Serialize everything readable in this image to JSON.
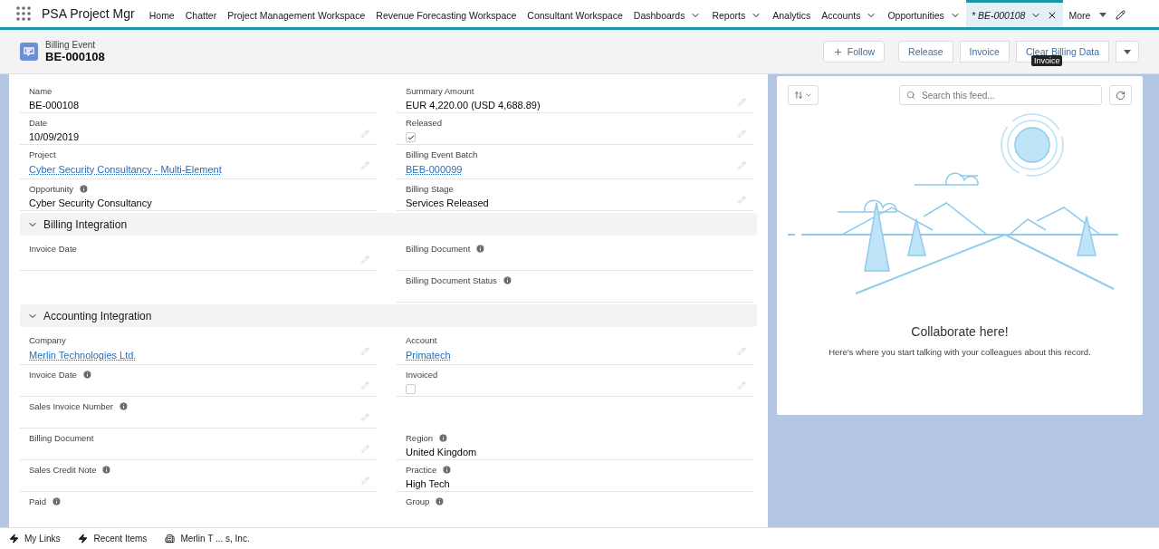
{
  "app": {
    "name": "PSA Project Mgr"
  },
  "nav_items": [
    {
      "label": "Home",
      "dropdown": false,
      "selected": false,
      "closable": false
    },
    {
      "label": "Chatter",
      "dropdown": false,
      "selected": false,
      "closable": false
    },
    {
      "label": "Project Management Workspace",
      "dropdown": false,
      "selected": false,
      "closable": false
    },
    {
      "label": "Revenue Forecasting Workspace",
      "dropdown": false,
      "selected": false,
      "closable": false
    },
    {
      "label": "Consultant Workspace",
      "dropdown": false,
      "selected": false,
      "closable": false
    },
    {
      "label": "Dashboards",
      "dropdown": true,
      "selected": false,
      "closable": false
    },
    {
      "label": "Reports",
      "dropdown": true,
      "selected": false,
      "closable": false
    },
    {
      "label": "Analytics",
      "dropdown": false,
      "selected": false,
      "closable": false
    },
    {
      "label": "Accounts",
      "dropdown": true,
      "selected": false,
      "closable": false
    },
    {
      "label": "Opportunities",
      "dropdown": true,
      "selected": false,
      "closable": false
    },
    {
      "label": "* BE-000108",
      "dropdown": true,
      "selected": true,
      "closable": true
    }
  ],
  "nav_more": "More",
  "record": {
    "type": "Billing Event",
    "title": "BE-000108"
  },
  "actions": [
    {
      "kind": "follow",
      "label": "Follow"
    },
    {
      "kind": "group",
      "label": "Release"
    },
    {
      "kind": "group",
      "label": "Invoice"
    },
    {
      "kind": "group",
      "label": "Clear Billing Data"
    },
    {
      "kind": "menu"
    }
  ],
  "tooltip": "Invoice",
  "sections": [
    {
      "rows": [
        {
          "left": {
            "label": "Name",
            "info": false,
            "kind": "text",
            "value": "BE-000108",
            "editable": false
          },
          "right": {
            "label": "Summary Amount",
            "info": false,
            "kind": "text",
            "value": "EUR 4,220.00 (USD 4,688.89)",
            "editable": true
          }
        },
        {
          "left": {
            "label": "Date",
            "info": false,
            "kind": "text",
            "value": "10/09/2019",
            "editable": true
          },
          "right": {
            "label": "Released",
            "info": false,
            "kind": "checkbox",
            "checked": true,
            "editable": true
          }
        },
        {
          "left": {
            "label": "Project",
            "info": false,
            "kind": "link",
            "value": "Cyber Security Consultancy - Multi-Element",
            "editable": true
          },
          "right": {
            "label": "Billing Event Batch",
            "info": false,
            "kind": "link",
            "value": "BEB-000099",
            "editable": true
          }
        },
        {
          "left": {
            "label": "Opportunity",
            "info": true,
            "kind": "text",
            "value": "Cyber Security Consultancy",
            "editable": false
          },
          "right": {
            "label": "Billing Stage",
            "info": false,
            "kind": "text",
            "value": "Services Released",
            "editable": true
          }
        }
      ]
    },
    {
      "title": "Billing Integration",
      "expanded": true,
      "rows": [
        {
          "left": {
            "label": "Invoice Date",
            "info": false,
            "kind": "empty",
            "editable": true
          },
          "right": {
            "label": "Billing Document",
            "info": true,
            "kind": "empty",
            "editable": false
          }
        },
        {
          "right": {
            "label": "Billing Document Status",
            "info": true,
            "kind": "empty",
            "editable": false
          }
        }
      ]
    },
    {
      "title": "Accounting Integration",
      "expanded": true,
      "rows": [
        {
          "left": {
            "label": "Company",
            "info": false,
            "kind": "link",
            "value": "Merlin Technologies Ltd.",
            "editable": true
          },
          "right": {
            "label": "Account",
            "info": false,
            "kind": "link",
            "value": "Primatech",
            "editable": true
          }
        },
        {
          "left": {
            "label": "Invoice Date",
            "info": true,
            "kind": "empty",
            "editable": true
          },
          "right": {
            "label": "Invoiced",
            "info": false,
            "kind": "checkbox",
            "checked": false,
            "editable": true
          }
        },
        {
          "left": {
            "label": "Sales Invoice Number",
            "info": true,
            "kind": "empty",
            "editable": true
          }
        },
        {
          "left": {
            "label": "Billing Document",
            "info": false,
            "kind": "empty",
            "editable": true
          },
          "right": {
            "label": "Region",
            "info": true,
            "kind": "text",
            "value": "United Kingdom",
            "editable": false
          }
        },
        {
          "left": {
            "label": "Sales Credit Note",
            "info": true,
            "kind": "empty",
            "editable": true
          },
          "right": {
            "label": "Practice",
            "info": true,
            "kind": "text",
            "value": "High Tech",
            "editable": false
          }
        },
        {
          "left": {
            "label": "Paid",
            "info": true,
            "kind": "cut"
          },
          "right": {
            "label": "Group",
            "info": true,
            "kind": "cut"
          }
        }
      ]
    }
  ],
  "feed": {
    "search": {
      "placeholder": "Search this feed..."
    },
    "heading": "Collaborate here!",
    "message": "Here's where you start talking with your colleagues about this record."
  },
  "utility_bar": [
    {
      "kind": "bolt",
      "label": "My Links"
    },
    {
      "kind": "bolt",
      "label": "Recent Items"
    },
    {
      "kind": "building",
      "label": "Merlin T ... s, Inc."
    }
  ]
}
